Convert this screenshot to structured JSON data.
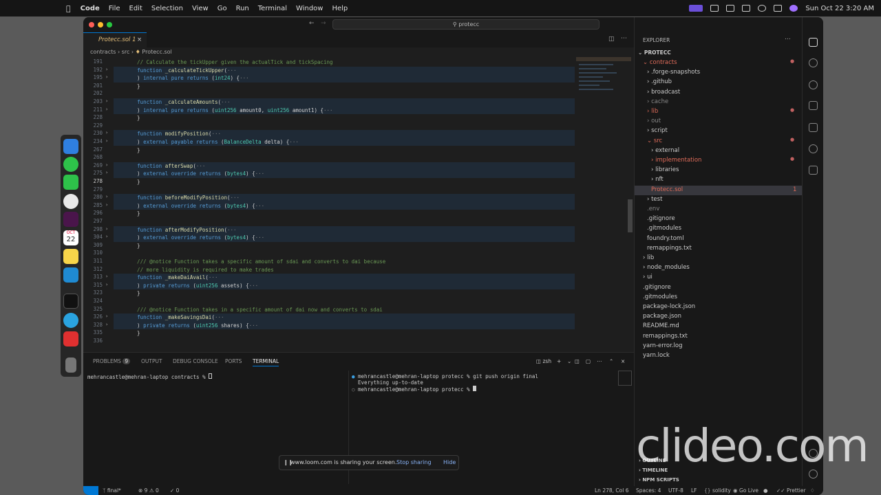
{
  "menubar": {
    "app": "Code",
    "items": [
      "File",
      "Edit",
      "Selection",
      "View",
      "Go",
      "Run",
      "Terminal",
      "Window",
      "Help"
    ],
    "datetime": "Sun Oct 22  3:20 AM"
  },
  "dock": {
    "calendar_day": "22",
    "calendar_month": "OCT"
  },
  "window": {
    "search": "protecc",
    "tab": {
      "label": "Protecc.sol 1"
    },
    "breadcrumb": [
      "contracts",
      "src",
      "Protecc.sol"
    ]
  },
  "editor": {
    "lines": [
      {
        "n": "191",
        "t": "    // Calculate the tickUpper given the actualTick and tickSpacing",
        "c": "cm"
      },
      {
        "n": "192",
        "t": "    function _calculateTickUpper(···",
        "c": "fnl",
        "f": 1
      },
      {
        "n": "195",
        "t": "    ) internal pure returns (int24) {···",
        "c": "kwl",
        "f": 1
      },
      {
        "n": "201",
        "t": "    }",
        "c": ""
      },
      {
        "n": "202",
        "t": "",
        "c": ""
      },
      {
        "n": "203",
        "t": "    function _calculateAmounts(···",
        "c": "fnl",
        "f": 1
      },
      {
        "n": "211",
        "t": "    ) internal pure returns (uint256 amount0, uint256 amount1) {···",
        "c": "kwl",
        "f": 1
      },
      {
        "n": "228",
        "t": "    }",
        "c": ""
      },
      {
        "n": "229",
        "t": "",
        "c": ""
      },
      {
        "n": "230",
        "t": "    function modifyPosition(···",
        "c": "fnl",
        "f": 1
      },
      {
        "n": "234",
        "t": "    ) external payable returns (BalanceDelta delta) {···",
        "c": "kwl",
        "f": 1
      },
      {
        "n": "267",
        "t": "    }",
        "c": ""
      },
      {
        "n": "268",
        "t": "",
        "c": ""
      },
      {
        "n": "269",
        "t": "    function afterSwap(···",
        "c": "fnl",
        "f": 1
      },
      {
        "n": "275",
        "t": "    ) external override returns (bytes4) {···",
        "c": "kwl",
        "f": 1
      },
      {
        "n": "278",
        "t": "    }",
        "c": ""
      },
      {
        "n": "279",
        "t": "",
        "c": ""
      },
      {
        "n": "280",
        "t": "    function beforeModifyPosition(···",
        "c": "fnl",
        "f": 1
      },
      {
        "n": "285",
        "t": "    ) external override returns (bytes4) {···",
        "c": "kwl",
        "f": 1
      },
      {
        "n": "296",
        "t": "    }",
        "c": ""
      },
      {
        "n": "297",
        "t": "",
        "c": ""
      },
      {
        "n": "298",
        "t": "    function afterModifyPosition(···",
        "c": "fnl",
        "f": 1
      },
      {
        "n": "304",
        "t": "    ) external override returns (bytes4) {···",
        "c": "kwl",
        "f": 1
      },
      {
        "n": "309",
        "t": "    }",
        "c": ""
      },
      {
        "n": "310",
        "t": "",
        "c": ""
      },
      {
        "n": "311",
        "t": "    /// @notice Function takes a specific amount of sdai and converts to dai because",
        "c": "cm"
      },
      {
        "n": "312",
        "t": "    // more liquidity is required to make trades",
        "c": "cm"
      },
      {
        "n": "313",
        "t": "    function _makeDaiAvail(···",
        "c": "fnl",
        "f": 1
      },
      {
        "n": "315",
        "t": "    ) private returns (uint256 assets) {···",
        "c": "kwl",
        "f": 1
      },
      {
        "n": "323",
        "t": "    }",
        "c": ""
      },
      {
        "n": "324",
        "t": "",
        "c": ""
      },
      {
        "n": "325",
        "t": "    /// @notice Function takes in a specific amount of dai now and converts to sdai",
        "c": "cm"
      },
      {
        "n": "326",
        "t": "    function _makeSavingsDai(···",
        "c": "fnl",
        "f": 1
      },
      {
        "n": "328",
        "t": "    ) private returns (uint256 shares) {···",
        "c": "kwl",
        "f": 1
      },
      {
        "n": "335",
        "t": "    }",
        "c": ""
      },
      {
        "n": "336",
        "t": "",
        "c": ""
      }
    ]
  },
  "panel": {
    "tabs": [
      "PROBLEMS",
      "OUTPUT",
      "DEBUG CONSOLE",
      "PORTS",
      "TERMINAL"
    ],
    "problems_count": "9",
    "shell": "zsh",
    "term_left": "mehrancastle@mehran-laptop contracts % ",
    "term_right": [
      "mehrancastle@mehran-laptop protecc % git push origin final",
      "Everything up-to-date",
      "mehrancastle@mehran-laptop protecc % "
    ]
  },
  "explorer": {
    "title": "EXPLORER",
    "root": "PROTECC",
    "items": [
      {
        "label": "contracts",
        "d": 1,
        "open": true,
        "red": true,
        "dot": true
      },
      {
        "label": ".forge-snapshots",
        "d": 2
      },
      {
        "label": ".github",
        "d": 2
      },
      {
        "label": "broadcast",
        "d": 2
      },
      {
        "label": "cache",
        "d": 2,
        "dimmed": true
      },
      {
        "label": "lib",
        "d": 2,
        "red": true,
        "dot": true
      },
      {
        "label": "out",
        "d": 2,
        "dimmed": true
      },
      {
        "label": "script",
        "d": 2
      },
      {
        "label": "src",
        "d": 2,
        "open": true,
        "red": true,
        "dot": true
      },
      {
        "label": "external",
        "d": 3
      },
      {
        "label": "implementation",
        "d": 3,
        "red": true,
        "dot": true
      },
      {
        "label": "libraries",
        "d": 3
      },
      {
        "label": "nft",
        "d": 3
      },
      {
        "label": "Protecc.sol",
        "d": 3,
        "file": true,
        "red": true,
        "badge": "1",
        "selected": true
      },
      {
        "label": "test",
        "d": 2
      },
      {
        "label": ".env",
        "d": 2,
        "file": true,
        "dimmed": true
      },
      {
        "label": ".gitignore",
        "d": 2,
        "file": true
      },
      {
        "label": ".gitmodules",
        "d": 2,
        "file": true
      },
      {
        "label": "foundry.toml",
        "d": 2,
        "file": true
      },
      {
        "label": "remappings.txt",
        "d": 2,
        "file": true
      },
      {
        "label": "lib",
        "d": 1
      },
      {
        "label": "node_modules",
        "d": 1
      },
      {
        "label": "ui",
        "d": 1
      },
      {
        "label": ".gitignore",
        "d": 1,
        "file": true
      },
      {
        "label": ".gitmodules",
        "d": 1,
        "file": true
      },
      {
        "label": "package-lock.json",
        "d": 1,
        "file": true
      },
      {
        "label": "package.json",
        "d": 1,
        "file": true
      },
      {
        "label": "README.md",
        "d": 1,
        "file": true
      },
      {
        "label": "remappings.txt",
        "d": 1,
        "file": true
      },
      {
        "label": "yarn-error.log",
        "d": 1,
        "file": true
      },
      {
        "label": "yarn.lock",
        "d": 1,
        "file": true
      }
    ],
    "sections": [
      "OUTLINE",
      "TIMELINE",
      "NPM SCRIPTS"
    ]
  },
  "status": {
    "branch": "final*",
    "errors": "9",
    "warnings": "0",
    "ports": "0",
    "position": "Ln 278, Col 6",
    "spaces": "Spaces: 4",
    "encoding": "UTF-8",
    "eol": "LF",
    "lang": "solidity",
    "golive": "Go Live",
    "prettier": "Prettier"
  },
  "loom": {
    "text": "www.loom.com is sharing your screen.",
    "stop": "Stop sharing",
    "hide": "Hide"
  },
  "watermark": "clideo.com"
}
